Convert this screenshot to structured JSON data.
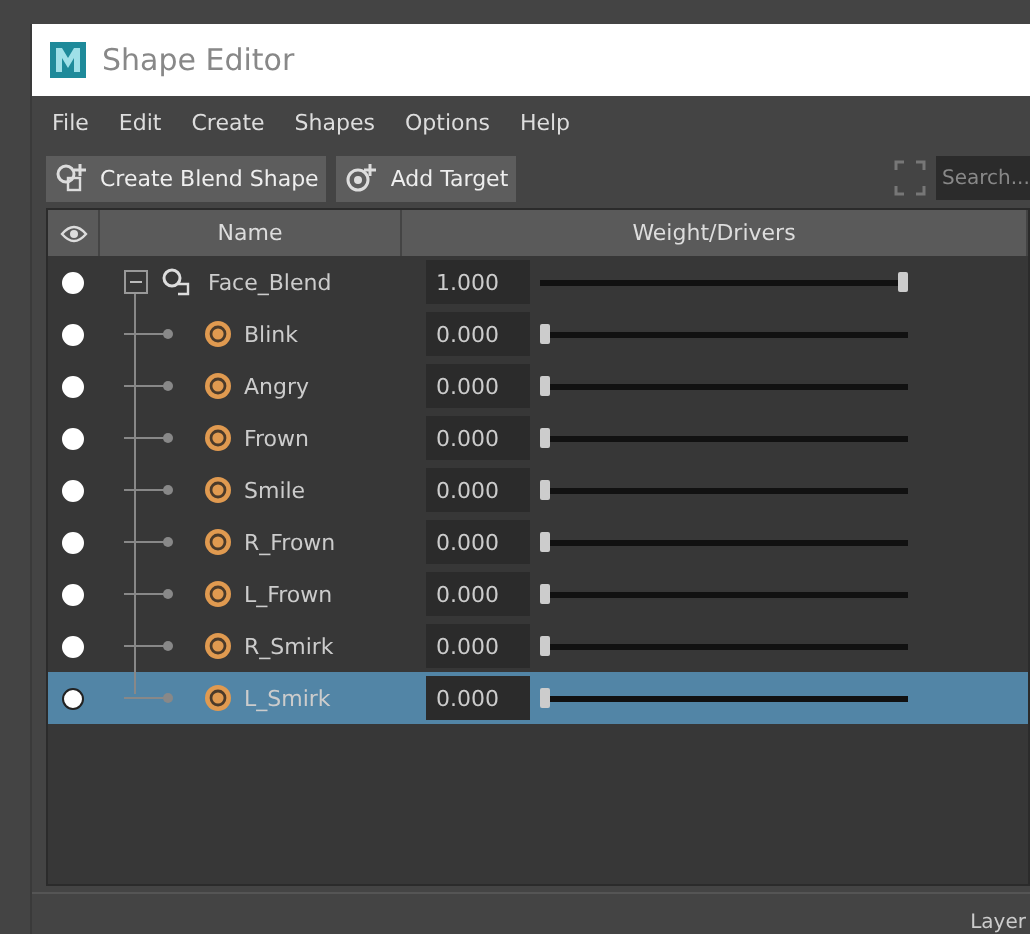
{
  "window": {
    "title": "Shape Editor"
  },
  "menu": [
    "File",
    "Edit",
    "Create",
    "Shapes",
    "Options",
    "Help"
  ],
  "toolbar": {
    "buttons": [
      "Create Blend Shape",
      "Add Target"
    ],
    "search": {
      "placeholder": "Search..."
    }
  },
  "table": {
    "columns": [
      "Name",
      "Weight/Drivers"
    ],
    "rows": [
      {
        "kind": "blend",
        "name": "Face_Blend",
        "value": "1.000",
        "level": 1,
        "visible": true,
        "selected": false,
        "children": [
          {
            "kind": "target",
            "name": "Blink",
            "value": "0.000",
            "level": 0,
            "visible": true,
            "selected": false
          },
          {
            "kind": "target",
            "name": "Angry",
            "value": "0.000",
            "level": 0,
            "visible": true,
            "selected": false
          },
          {
            "kind": "target",
            "name": "Frown",
            "value": "0.000",
            "level": 0,
            "visible": true,
            "selected": false
          },
          {
            "kind": "target",
            "name": "Smile",
            "value": "0.000",
            "level": 0,
            "visible": true,
            "selected": false
          },
          {
            "kind": "target",
            "name": "R_Frown",
            "value": "0.000",
            "level": 0,
            "visible": true,
            "selected": false
          },
          {
            "kind": "target",
            "name": "L_Frown",
            "value": "0.000",
            "level": 0,
            "visible": true,
            "selected": false
          },
          {
            "kind": "target",
            "name": "R_Smirk",
            "value": "0.000",
            "level": 0,
            "visible": true,
            "selected": false
          },
          {
            "kind": "target",
            "name": "L_Smirk",
            "value": "0.000",
            "level": 0,
            "visible": true,
            "selected": true
          }
        ]
      }
    ]
  },
  "side_panel": {
    "label": "Layer"
  }
}
